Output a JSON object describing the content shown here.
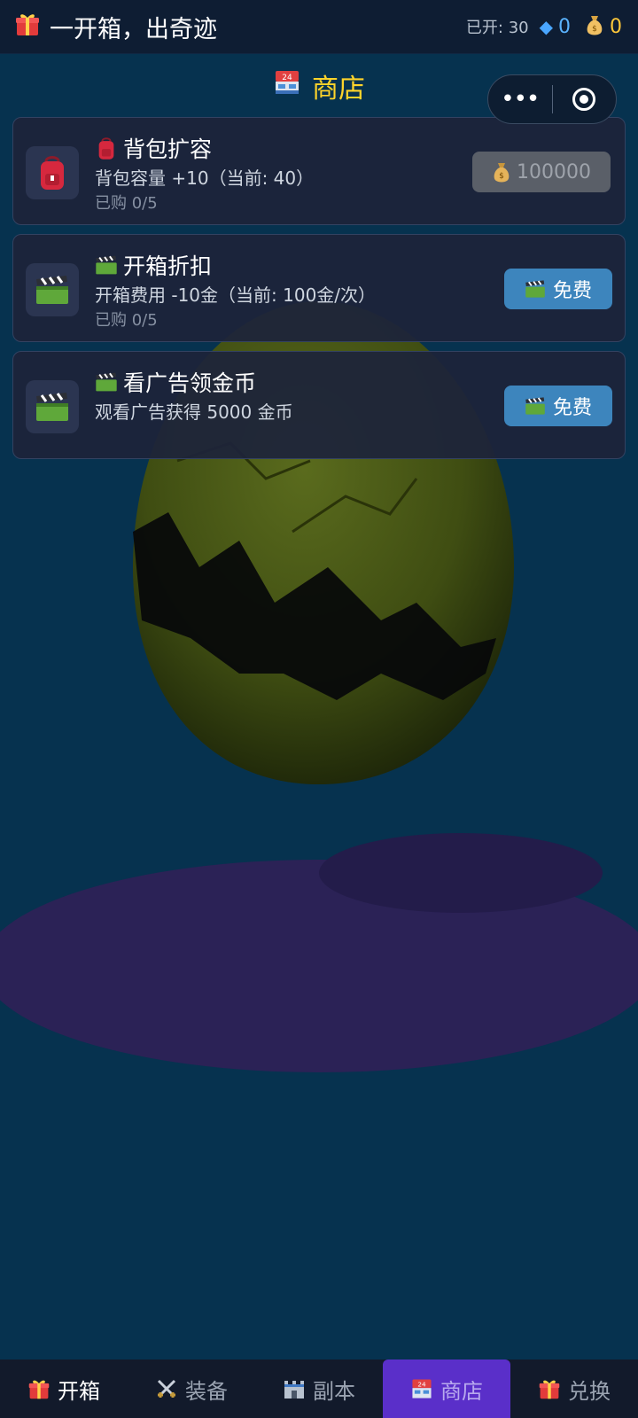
{
  "header": {
    "title": "一开箱，出奇迹",
    "opened": "已开: 30",
    "gems": "0",
    "coins": "0"
  },
  "shop": {
    "title": "商店"
  },
  "capsule": {
    "more": "•••"
  },
  "items": [
    {
      "title": "背包扩容",
      "desc": "背包容量 +10（当前: 40）",
      "count": "已购 0/5",
      "button": "100000",
      "icon": "backpack-icon"
    },
    {
      "title": "开箱折扣",
      "desc": "开箱费用 -10金（当前: 100金/次）",
      "count": "已购 0/5",
      "button": "免费",
      "icon": "clapperboard-icon"
    },
    {
      "title": "看广告领金币",
      "desc": "观看广告获得 5000 金币",
      "button": "免费",
      "icon": "clapperboard-icon"
    }
  ],
  "nav": [
    {
      "label": "开箱",
      "icon": "gift-icon"
    },
    {
      "label": "装备",
      "icon": "crossed-swords-icon"
    },
    {
      "label": "副本",
      "icon": "castle-icon"
    },
    {
      "label": "商店",
      "icon": "store-icon"
    },
    {
      "label": "兑换",
      "icon": "gift-icon"
    }
  ],
  "colors": {
    "background": "#06324f",
    "accent_yellow": "#ffd42a",
    "button_blue": "#3d85bd",
    "nav_active": "#5a2fc9"
  }
}
